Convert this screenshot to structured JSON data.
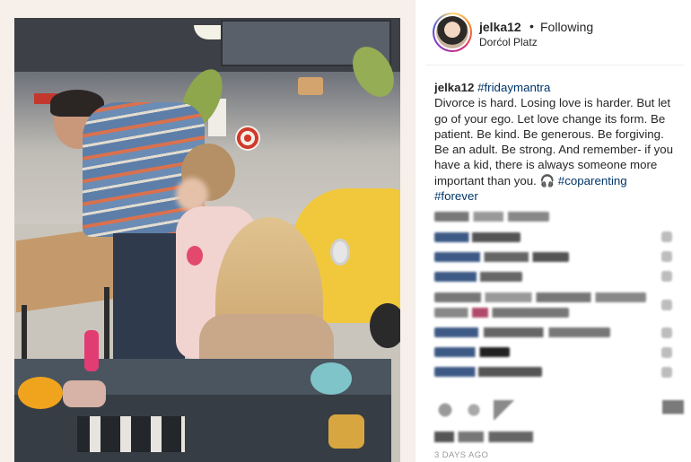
{
  "header": {
    "username": "jelka12",
    "separator": "•",
    "follow_status": "Following",
    "location": "Dorćol Platz"
  },
  "caption": {
    "username": "jelka12",
    "hashtag_1": "#fridaymantra",
    "text": "Divorce is hard. Losing love is harder. But let go of your ego. Let love change its form. Be patient. Be kind. Be generous. Be forgiving. Be an adult. Be strong. And remember- if you have a kid, there is always someone more important than you. 🎧",
    "hashtag_2": "#coparenting",
    "hashtag_3": "#forever"
  },
  "timestamp": "3 DAYS AGO",
  "colors": {
    "text": "#262626",
    "hashtag": "#003569",
    "muted": "#999999",
    "post_background": "#f7efe9"
  },
  "icons": {
    "like": "heart-icon",
    "comment": "comment-icon",
    "share": "share-icon",
    "save": "bookmark-icon"
  }
}
